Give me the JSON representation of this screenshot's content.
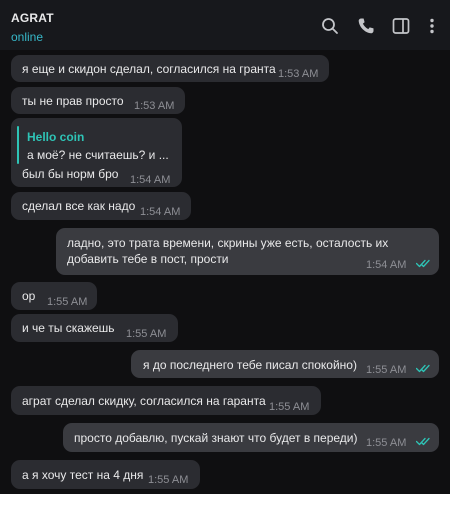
{
  "chat": {
    "title": "AGRAT",
    "status": "online"
  },
  "icons": {
    "search": "search-icon",
    "call": "phone-icon",
    "sidebar": "sidebar-toggle-icon",
    "menu": "more-vertical-icon"
  },
  "colors": {
    "background": "#0f0f11",
    "header": "#17181c",
    "incoming_bubble": "#2b2c31",
    "outgoing_bubble": "#3a3b40",
    "online_status": "#37b8c9",
    "reply_accent": "#2ec4b6",
    "read_checks": "#2ec4b6",
    "time_text": "#8e8f95"
  },
  "messages": [
    {
      "direction": "in",
      "text": "я еще и скидон сделал, согласился на гранта",
      "time": "1:53 AM"
    },
    {
      "direction": "in",
      "text": "ты не прав просто",
      "time": "1:53 AM"
    },
    {
      "direction": "in",
      "reply": {
        "author": "Hello coin",
        "text": "а моё? не считаешь? и ..."
      },
      "text": "был бы норм бро",
      "time": "1:54 AM"
    },
    {
      "direction": "in",
      "text": "сделал все как надо",
      "time": "1:54 AM"
    },
    {
      "direction": "out",
      "text_lines": [
        "ладно, это трата времени, скрины уже есть, осталость их",
        "добавить тебе в пост, прости"
      ],
      "time": "1:54 AM",
      "read": true
    },
    {
      "direction": "in",
      "text": "ор",
      "time": "1:55 AM"
    },
    {
      "direction": "in",
      "text": "и че ты скажешь",
      "time": "1:55 AM"
    },
    {
      "direction": "out",
      "text": "я до последнего тебе писал спокойно)",
      "time": "1:55 AM",
      "read": true
    },
    {
      "direction": "in",
      "text": "аграт сделал скидку, согласился на гаранта",
      "time": "1:55 AM"
    },
    {
      "direction": "out",
      "text": "просто добавлю, пускай знают что будет в переди)",
      "time": "1:55 AM",
      "read": true
    },
    {
      "direction": "in",
      "text": "а я хочу тест на 4 дня",
      "time": "1:55 AM"
    }
  ]
}
